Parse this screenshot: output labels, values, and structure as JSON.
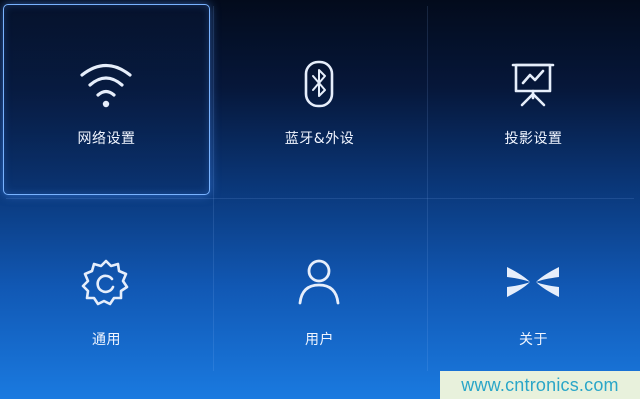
{
  "menu": {
    "items": [
      {
        "label": "网络设置",
        "icon": "wifi-icon",
        "selected": true
      },
      {
        "label": "蓝牙&外设",
        "icon": "bluetooth-icon",
        "selected": false
      },
      {
        "label": "投影设置",
        "icon": "projector-icon",
        "selected": false
      },
      {
        "label": "通用",
        "icon": "gear-icon",
        "selected": false
      },
      {
        "label": "用户",
        "icon": "user-icon",
        "selected": false
      },
      {
        "label": "关于",
        "icon": "about-icon",
        "selected": false
      }
    ]
  },
  "colors": {
    "accent": "#79b3ff",
    "icon": "#e6eefb",
    "watermark_text": "#2aa6c8",
    "watermark_bg": "#e8f1dc"
  },
  "watermark": {
    "text": "www.cntronics.com"
  }
}
